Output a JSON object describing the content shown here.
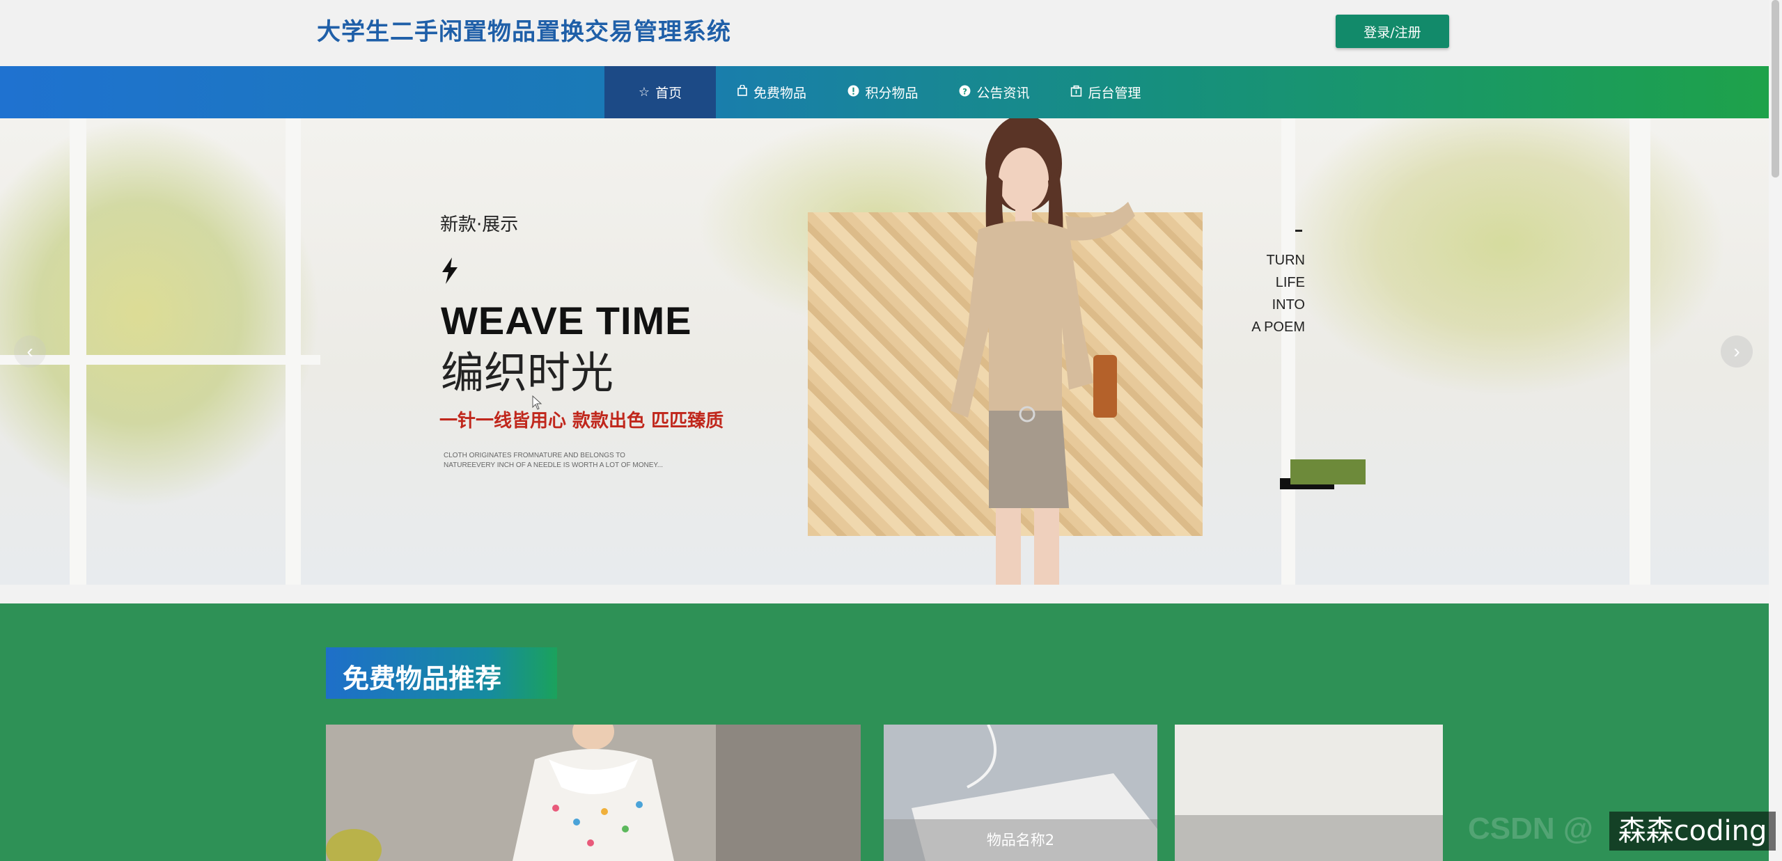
{
  "header": {
    "site_title": "大学生二手闲置物品置换交易管理系统",
    "login_label": "登录/注册"
  },
  "nav": {
    "items": [
      {
        "label": "首页",
        "icon": "star-icon",
        "active": true
      },
      {
        "label": "免费物品",
        "icon": "bag-icon",
        "active": false
      },
      {
        "label": "积分物品",
        "icon": "info-circle-icon",
        "active": false
      },
      {
        "label": "公告资讯",
        "icon": "question-circle-icon",
        "active": false
      },
      {
        "label": "后台管理",
        "icon": "box-icon",
        "active": false
      }
    ]
  },
  "banner": {
    "subtitle": "新款·展示",
    "title_en": "WEAVE TIME",
    "title_cn": "编织时光",
    "slogan": "一针一线皆用心 款款出色 匹匹臻质",
    "small_text": "CLOTH ORIGINATES FROMNATURE AND BELONGS TO NATUREEVERY INCH OF A NEEDLE IS WORTH A LOT OF MONEY...",
    "poem": [
      "TURN",
      "LIFE",
      "INTO",
      "A POEM"
    ]
  },
  "free_section": {
    "title": "免费物品推荐",
    "cards": [
      {
        "label": ""
      },
      {
        "label": "物品名称2"
      },
      {
        "label": ""
      }
    ]
  },
  "watermark": {
    "text": "森森coding",
    "faint": "CSDN @"
  },
  "colors": {
    "title_blue": "#1f5fa8",
    "login_green": "#128a6a",
    "nav_active": "#1c4a86",
    "section_green": "#2e9156",
    "slogan_red": "#c0271c"
  }
}
